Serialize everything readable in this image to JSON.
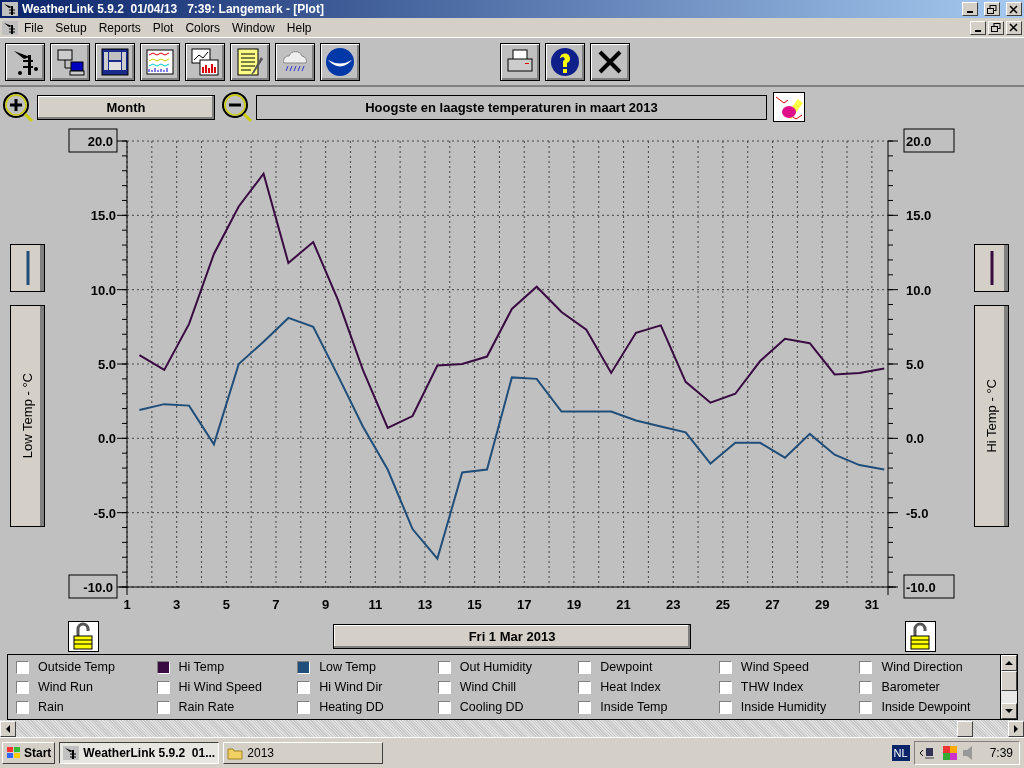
{
  "window": {
    "title": "WeatherLink 5.9.2  01/04/13   7:39: Langemark - [Plot]"
  },
  "menu": [
    "File",
    "Setup",
    "Reports",
    "Plot",
    "Colors",
    "Window",
    "Help"
  ],
  "plot_controls": {
    "period": "Month",
    "title_field": {
      "value": "Hoogste en laagste temperaturen in maart 2013"
    }
  },
  "left_axis": {
    "label": "Low Temp - °C",
    "color": "#1f4e7a"
  },
  "right_axis": {
    "label": "Hi Temp - °C",
    "color": "#3a0a42"
  },
  "chart_data": {
    "type": "line",
    "x": [
      1.5,
      2.5,
      3.5,
      4.5,
      5.5,
      6.5,
      7.5,
      8.5,
      9.5,
      10.5,
      11.5,
      12.5,
      13.5,
      14.5,
      15.5,
      16.5,
      17.5,
      18.5,
      19.5,
      20.5,
      21.5,
      22.5,
      23.5,
      24.5,
      25.5,
      26.5,
      27.5,
      28.5,
      29.5,
      30.5,
      31.5
    ],
    "series": [
      {
        "color": "#3a0a42",
        "values": [
          5.6,
          4.6,
          7.7,
          12.4,
          15.6,
          17.8,
          11.8,
          13.2,
          9.3,
          4.6,
          0.7,
          1.5,
          4.9,
          5.0,
          5.5,
          8.7,
          10.2,
          8.5,
          7.3,
          4.4,
          7.1,
          7.6,
          3.8,
          2.4,
          3.0,
          5.2,
          6.7,
          6.4,
          4.3,
          4.4,
          4.7
        ]
      },
      {
        "color": "#1f4e7a",
        "values": [
          1.9,
          2.3,
          2.2,
          -0.4,
          5.0,
          6.5,
          8.1,
          7.5,
          4.2,
          0.8,
          -2.1,
          -6.1,
          -8.1,
          -2.3,
          -2.1,
          4.1,
          4.0,
          1.8,
          1.8,
          1.8,
          1.2,
          0.8,
          0.4,
          -1.7,
          -0.3,
          -0.3,
          -1.3,
          0.3,
          -1.1,
          -1.8,
          -2.1
        ]
      }
    ],
    "grid": true,
    "xlim": [
      1,
      31.65
    ],
    "ylim": [
      -10,
      20
    ],
    "xticks": [
      1,
      3,
      5,
      7,
      9,
      11,
      13,
      15,
      17,
      19,
      21,
      23,
      25,
      27,
      29,
      31
    ],
    "yticks": [
      {
        "value": 20,
        "label": "20.0"
      },
      {
        "value": 15,
        "label": "15.0"
      },
      {
        "value": 10,
        "label": "10.0"
      },
      {
        "value": 5,
        "label": "5.0"
      },
      {
        "value": 0,
        "label": "0.0"
      },
      {
        "value": -5,
        "label": "-5.0"
      },
      {
        "value": -10,
        "label": "-10.0"
      }
    ]
  },
  "date_button": "Fri 1 Mar 2013",
  "legend": {
    "items": [
      {
        "label": "Outside Temp",
        "checked": false
      },
      {
        "label": "Hi Temp",
        "checked": true,
        "color": "#3a0a42"
      },
      {
        "label": "Low Temp",
        "checked": true,
        "color": "#1f4e7a"
      },
      {
        "label": "Out Humidity",
        "checked": false
      },
      {
        "label": "Dewpoint",
        "checked": false
      },
      {
        "label": "Wind Speed",
        "checked": false
      },
      {
        "label": "Wind Direction",
        "checked": false
      },
      {
        "label": "Wind Run",
        "checked": false
      },
      {
        "label": "Hi Wind Speed",
        "checked": false
      },
      {
        "label": "Hi Wind Dir",
        "checked": false
      },
      {
        "label": "Wind Chill",
        "checked": false
      },
      {
        "label": "Heat Index",
        "checked": false
      },
      {
        "label": "THW Index",
        "checked": false
      },
      {
        "label": "Barometer",
        "checked": false
      },
      {
        "label": "Rain",
        "checked": false
      },
      {
        "label": "Rain Rate",
        "checked": false
      },
      {
        "label": "Heating DD",
        "checked": false
      },
      {
        "label": "Cooling DD",
        "checked": false
      },
      {
        "label": "Inside Temp",
        "checked": false
      },
      {
        "label": "Inside Humidity",
        "checked": false
      },
      {
        "label": "Inside Dewpoint",
        "checked": false
      }
    ]
  },
  "taskbar": {
    "start": "Start",
    "tasks": [
      {
        "label": "WeatherLink 5.9.2  01...",
        "selected": true
      },
      {
        "label": "2013",
        "selected": false
      }
    ],
    "language": "NL",
    "clock": "7:39"
  }
}
